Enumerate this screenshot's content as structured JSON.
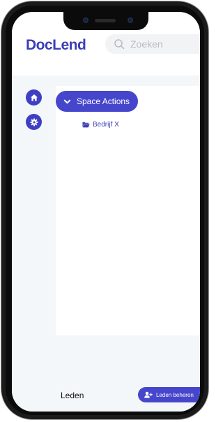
{
  "app": {
    "logo": "DocLend"
  },
  "search": {
    "placeholder": "Zoeken"
  },
  "sidebar": {
    "icons": [
      "home-icon",
      "gear-icon"
    ]
  },
  "space": {
    "button_label": "Space Actions",
    "items": [
      {
        "label": "Bedrijf X",
        "icon": "folder-open-icon"
      }
    ]
  },
  "members": {
    "label": "Leden",
    "manage_button": "Leden beheren"
  },
  "colors": {
    "brand": "#3b3eb8",
    "accent": "#4646cc",
    "background": "#f4f7fa"
  }
}
